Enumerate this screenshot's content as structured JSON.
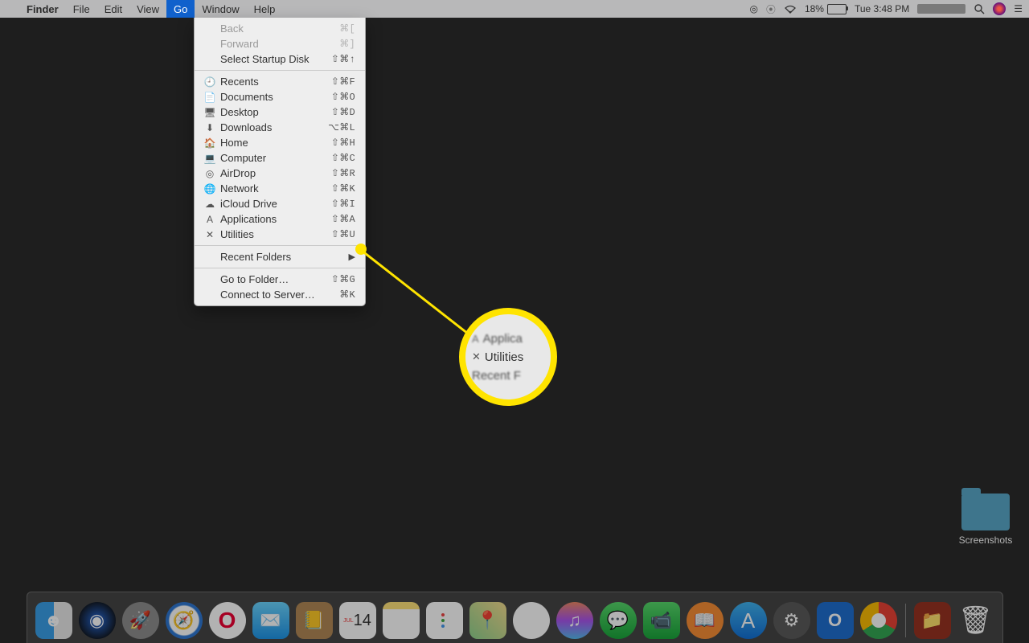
{
  "menubar": {
    "app": "Finder",
    "items": [
      "File",
      "Edit",
      "View",
      "Go",
      "Window",
      "Help"
    ],
    "selected": "Go"
  },
  "status": {
    "battery_pct": "18%",
    "clock": "Tue 3:48 PM"
  },
  "go_menu": {
    "nav": [
      {
        "label": "Back",
        "shortcut": "⌘[",
        "disabled": true
      },
      {
        "label": "Forward",
        "shortcut": "⌘]",
        "disabled": true
      },
      {
        "label": "Select Startup Disk",
        "shortcut": "⇧⌘↑"
      }
    ],
    "places": [
      {
        "icon": "🕘",
        "label": "Recents",
        "shortcut": "⇧⌘F"
      },
      {
        "icon": "📄",
        "label": "Documents",
        "shortcut": "⇧⌘O"
      },
      {
        "icon": "🖥",
        "label": "Desktop",
        "shortcut": "⇧⌘D"
      },
      {
        "icon": "⬇",
        "label": "Downloads",
        "shortcut": "⌥⌘L"
      },
      {
        "icon": "🏠",
        "label": "Home",
        "shortcut": "⇧⌘H"
      },
      {
        "icon": "💻",
        "label": "Computer",
        "shortcut": "⇧⌘C"
      },
      {
        "icon": "◎",
        "label": "AirDrop",
        "shortcut": "⇧⌘R"
      },
      {
        "icon": "🌐",
        "label": "Network",
        "shortcut": "⇧⌘K"
      },
      {
        "icon": "☁",
        "label": "iCloud Drive",
        "shortcut": "⇧⌘I"
      },
      {
        "icon": "A",
        "label": "Applications",
        "shortcut": "⇧⌘A"
      },
      {
        "icon": "✕",
        "label": "Utilities",
        "shortcut": "⇧⌘U"
      }
    ],
    "recent": {
      "label": "Recent Folders"
    },
    "bottom": [
      {
        "label": "Go to Folder…",
        "shortcut": "⇧⌘G"
      },
      {
        "label": "Connect to Server…",
        "shortcut": "⌘K"
      }
    ]
  },
  "magnifier": {
    "top": "Applica",
    "mid": "Utilities",
    "bot": "Recent F"
  },
  "desktop": {
    "folder": "Screenshots"
  },
  "dock": {
    "cal_day": "14"
  }
}
